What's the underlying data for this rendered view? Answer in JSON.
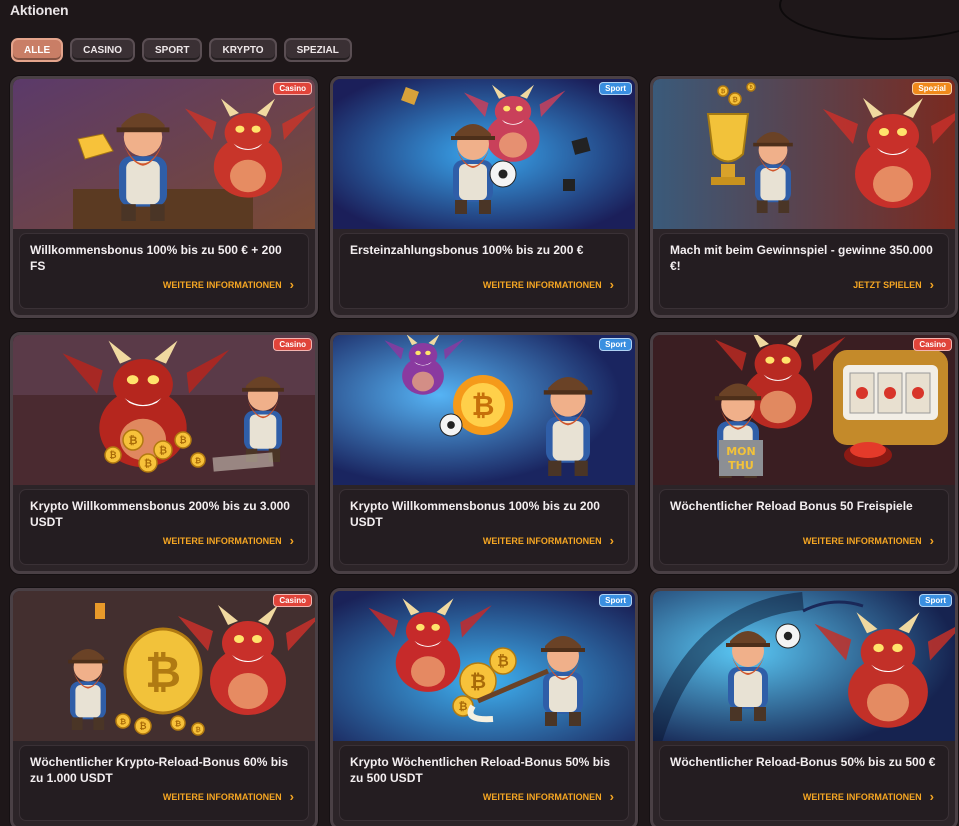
{
  "page": {
    "title": "Aktionen"
  },
  "filters": [
    {
      "label": "ALLE",
      "active": true
    },
    {
      "label": "CASINO",
      "active": false
    },
    {
      "label": "SPORT",
      "active": false
    },
    {
      "label": "KRYPTO",
      "active": false
    },
    {
      "label": "SPEZIAL",
      "active": false
    }
  ],
  "colors": {
    "casino_badge": "#e0443a",
    "sport_badge": "#3a8fe0",
    "spezial_badge": "#f08a1c",
    "link": "#f5a623",
    "active_filter": "#c97e66"
  },
  "promos": [
    {
      "badge": "Casino",
      "title": "Willkommensbonus 100% bis zu 500 € + 200 FS",
      "link": "WEITERE INFORMATIONEN",
      "art": "casino-gold"
    },
    {
      "badge": "Sport",
      "title": "Ersteinzahlungsbonus 100% bis zu 200 €",
      "link": "WEITERE INFORMATIONEN",
      "art": "sport-cave"
    },
    {
      "badge": "Spezial",
      "title": "Mach mit beim Gewinnspiel - gewinne 350.000 €!",
      "link": "JETZT SPIELEN",
      "art": "spezial-trophy"
    },
    {
      "badge": "Casino",
      "title": "Krypto Willkommensbonus 200% bis zu 3.000 USDT",
      "link": "WEITERE INFORMATIONEN",
      "art": "casino-coins"
    },
    {
      "badge": "Sport",
      "title": "Krypto Willkommensbonus 100% bis zu 200 USDT",
      "link": "WEITERE INFORMATIONEN",
      "art": "sport-fireball"
    },
    {
      "badge": "Casino",
      "title": "Wöchentlicher Reload Bonus 50 Freispiele",
      "link": "WEITERE INFORMATIONEN",
      "art": "casino-slot"
    },
    {
      "badge": "Casino",
      "title": "Wöchentlicher Krypto-Reload-Bonus 60% bis zu 1.000 USDT",
      "link": "WEITERE INFORMATIONEN",
      "art": "casino-bitcoin"
    },
    {
      "badge": "Sport",
      "title": "Krypto Wöchentlichen Reload-Bonus 50% bis zu 500 USDT",
      "link": "WEITERE INFORMATIONEN",
      "art": "sport-hockey"
    },
    {
      "badge": "Sport",
      "title": "Wöchentlicher Reload-Bonus 50% bis zu 500 €",
      "link": "WEITERE INFORMATIONEN",
      "art": "sport-tunnel"
    }
  ],
  "machine_art": {
    "slot_label_1": "MON",
    "slot_label_2": "THU"
  }
}
